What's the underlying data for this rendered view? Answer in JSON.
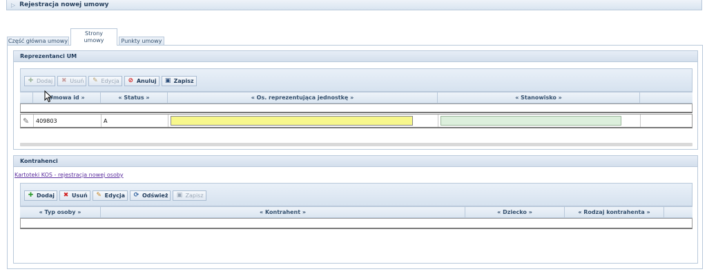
{
  "header": {
    "title": "Rejestracja nowej umowy",
    "icon": "collapse-triangle-icon"
  },
  "tabs": [
    {
      "label": "Część główna umowy",
      "active": false
    },
    {
      "label": "Strony umowy",
      "active": true
    },
    {
      "label": "Punkty umowy",
      "active": false
    }
  ],
  "representatives": {
    "title": "Reprezentanci UM",
    "toolbar": {
      "add": "Dodaj",
      "delete": "Usuń",
      "edit": "Edycja",
      "cancel": "Anuluj",
      "save": "Zapisz"
    },
    "columns": [
      "Umowa id »",
      "« Status »",
      "« Os. reprezentująca jednostkę »",
      "« Stanowisko »"
    ],
    "rows": [
      {
        "umowa_id": "409803",
        "status": "A",
        "osoba": "",
        "stanowisko": ""
      }
    ]
  },
  "contractors": {
    "title": "Kontrahenci",
    "link": "Kartoteki KOS - rejestracja nowej osoby",
    "toolbar": {
      "add": "Dodaj",
      "delete": "Usuń",
      "edit": "Edycja",
      "refresh": "Odśwież",
      "save": "Zapisz"
    },
    "columns": [
      "« Typ osoby »",
      "« Kontrahent »",
      "« Dziecko »",
      "« Rodzaj kontrahenta »"
    ]
  },
  "colors": {
    "accent": "#b8c8da",
    "input_yellow": "#f7f78c",
    "input_green": "#dcefdc"
  }
}
